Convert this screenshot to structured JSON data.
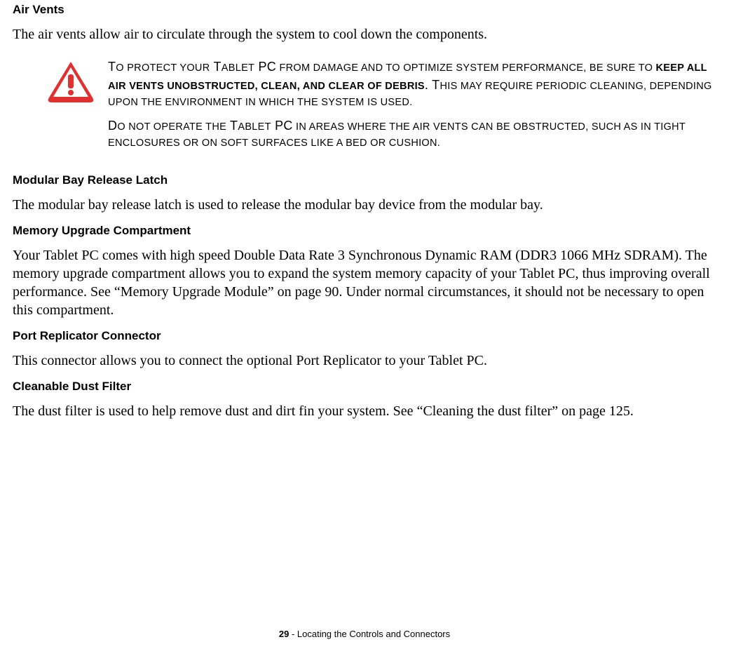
{
  "sections": {
    "airVents": {
      "heading": "Air Vents",
      "body": "The air vents allow air to circulate through the system to cool down the components."
    },
    "warning": {
      "p1_a": "T",
      "p1_b": "O PROTECT YOUR",
      "p1_c": " T",
      "p1_d": "ABLET",
      "p1_e": " PC",
      "p1_f": " FROM DAMAGE AND TO OPTIMIZE SYSTEM PERFORMANCE, BE SURE TO",
      "p1_g": " KEEP ALL AIR VENTS UNOBSTRUCTED, CLEAN, AND CLEAR OF DEBRIS",
      "p1_h": ". T",
      "p1_i": "HIS MAY REQUIRE PERIODIC CLEANING, DEPENDING UPON THE ENVIRONMENT IN WHICH THE SYSTEM IS USED.",
      "p2_a": "D",
      "p2_b": "O NOT OPERATE THE",
      "p2_c": " T",
      "p2_d": "ABLET",
      "p2_e": " PC",
      "p2_f": " IN AREAS WHERE THE AIR VENTS CAN BE OBSTRUCTED, SUCH AS IN TIGHT ENCLOSURES OR ON SOFT SURFACES LIKE A BED OR CUSHION."
    },
    "modularBay": {
      "heading": "Modular Bay Release Latch",
      "body": "The modular bay release latch is used to release the modular bay device from the modular bay."
    },
    "memoryUpgrade": {
      "heading": "Memory Upgrade Compartment",
      "body": "Your Tablet PC comes with high speed Double Data Rate 3 Synchronous Dynamic RAM (DDR3 1066 MHz SDRAM). The memory upgrade compartment allows you to expand the system memory capacity of your Tablet PC, thus improving overall performance. See “Memory Upgrade Module” on page 90. Under normal circumstances, it should not be necessary to open this compartment."
    },
    "portReplicator": {
      "heading": "Port Replicator Connector",
      "body": "This connector allows you to connect the optional Port Replicator to your Tablet PC."
    },
    "dustFilter": {
      "heading": "Cleanable Dust Filter",
      "body": "The dust filter is used to help remove dust and dirt fin your system. See “Cleaning the dust filter” on page 125."
    }
  },
  "footer": {
    "pageNumber": "29",
    "separator": " - ",
    "title": "Locating the Controls and Connectors"
  }
}
